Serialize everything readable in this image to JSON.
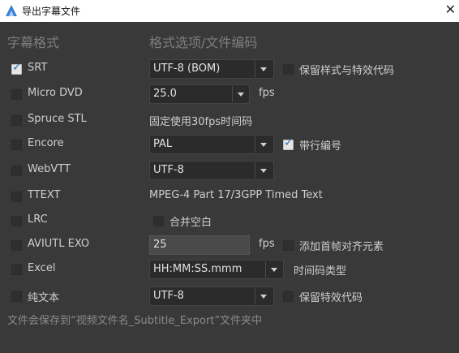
{
  "window": {
    "title": "导出字幕文件",
    "logo": "aegisub-logo-icon",
    "close_icon": "close-icon"
  },
  "headers": {
    "format": "字幕格式",
    "options": "格式选项/文件编码"
  },
  "rows": {
    "srt": {
      "label": "SRT",
      "checked": true,
      "encoding": "UTF-8 (BOM)",
      "opt_label": "保留样式与特效代码",
      "opt_checked": false
    },
    "microdvd": {
      "label": "Micro DVD",
      "checked": false,
      "fps_value": "25.0",
      "unit": "fps"
    },
    "spruce": {
      "label": "Spruce STL",
      "checked": false,
      "note": "固定使用30fps时间码"
    },
    "encore": {
      "label": "Encore",
      "checked": false,
      "standard": "PAL",
      "opt_label": "带行编号",
      "opt_checked": true
    },
    "webvtt": {
      "label": "WebVTT",
      "checked": false,
      "encoding": "UTF-8"
    },
    "ttext": {
      "label": "TTEXT",
      "checked": false,
      "note": "MPEG-4 Part 17/3GPP Timed Text"
    },
    "lrc": {
      "label": "LRC",
      "checked": false,
      "opt_label": "合并空白",
      "opt_checked": false
    },
    "aviutl": {
      "label": "AVIUTL EXO",
      "checked": false,
      "fps_value": "25",
      "unit": "fps",
      "opt_label": "添加首帧对齐元素",
      "opt_checked": false
    },
    "excel": {
      "label": "Excel",
      "checked": false,
      "timecode": "HH:MM:SS.mmm",
      "opt_note": "时间码类型"
    },
    "plain": {
      "label": "纯文本",
      "checked": false,
      "encoding": "UTF-8",
      "opt_label": "保留特效代码",
      "opt_checked": false
    }
  },
  "footer": "文件会保存到“视频文件名_Subtitle_Export”文件夹中"
}
